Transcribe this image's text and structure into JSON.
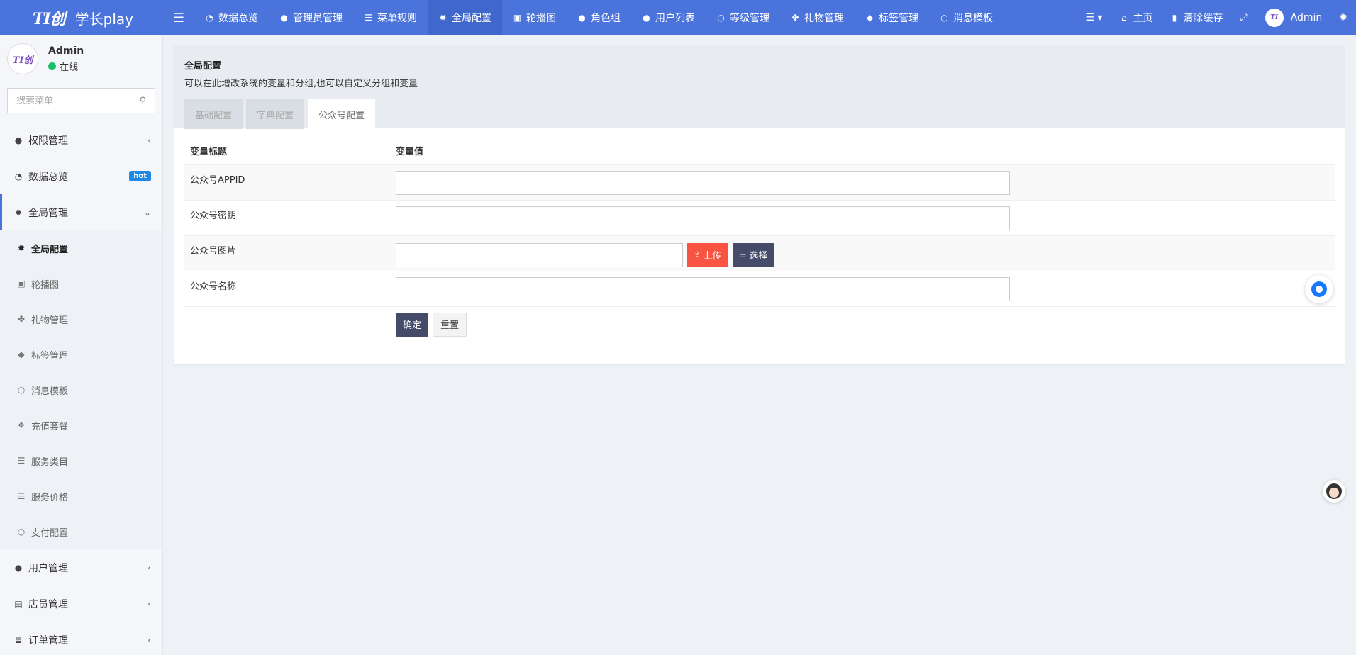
{
  "brand": {
    "logo": "TI创",
    "name": "学长play"
  },
  "topnav": {
    "items": [
      {
        "label": "数据总览",
        "icon": "dashboard-icon",
        "glyph": "◔"
      },
      {
        "label": "管理员管理",
        "icon": "user-icon",
        "glyph": "●"
      },
      {
        "label": "菜单规则",
        "icon": "bars-icon",
        "glyph": "☰"
      },
      {
        "label": "全局配置",
        "icon": "gear-icon",
        "glyph": "✹"
      },
      {
        "label": "轮播图",
        "icon": "image-icon",
        "glyph": "▣"
      },
      {
        "label": "角色组",
        "icon": "users-icon",
        "glyph": "●"
      },
      {
        "label": "用户列表",
        "icon": "user-icon",
        "glyph": "●"
      },
      {
        "label": "等级管理",
        "icon": "circle-icon",
        "glyph": "○"
      },
      {
        "label": "礼物管理",
        "icon": "gift-icon",
        "glyph": "✤"
      },
      {
        "label": "标签管理",
        "icon": "tags-icon",
        "glyph": "◆"
      },
      {
        "label": "消息模板",
        "icon": "circle-icon",
        "glyph": "○"
      }
    ],
    "right": {
      "home": "主页",
      "clear_cache": "清除缓存",
      "user": "Admin"
    }
  },
  "sidebar": {
    "user": {
      "name": "Admin",
      "status": "在线"
    },
    "search_placeholder": "搜索菜单",
    "menu": {
      "auth": "权限管理",
      "dashboard": "数据总览",
      "dashboard_badge": "hot",
      "global": "全局管理",
      "sub": [
        "全局配置",
        "轮播图",
        "礼物管理",
        "标签管理",
        "消息模板",
        "充值套餐",
        "服务类目",
        "服务价格",
        "支付配置"
      ],
      "users": "用户管理",
      "staff": "店员管理",
      "orders": "订单管理"
    }
  },
  "panel": {
    "title": "全局配置",
    "description": "可以在此增改系统的变量和分组,也可以自定义分组和变量",
    "tabs": [
      "基础配置",
      "字典配置",
      "公众号配置"
    ],
    "active_tab": "公众号配置",
    "table": {
      "headers": [
        "变量标题",
        "变量值"
      ],
      "rows": [
        {
          "label": "公众号APPID",
          "value": ""
        },
        {
          "label": "公众号密钥",
          "value": ""
        },
        {
          "label": "公众号图片",
          "value": ""
        },
        {
          "label": "公众号名称",
          "value": ""
        }
      ],
      "upload_label": "上传",
      "choose_label": "选择",
      "submit_label": "确定",
      "reset_label": "重置"
    }
  },
  "colors": {
    "topbar": "#4a74dc",
    "upload": "#f75444",
    "dark_button": "#444c69",
    "online": "#19be6b"
  }
}
